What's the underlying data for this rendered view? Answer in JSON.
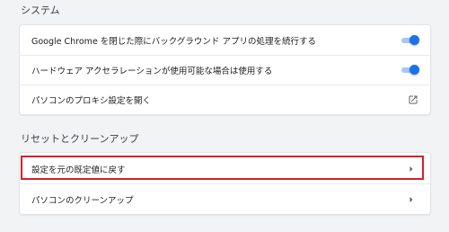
{
  "system": {
    "title": "システム",
    "items": [
      {
        "label": "Google Chrome を閉じた際にバックグラウンド アプリの処理を続行する",
        "enabled": true
      },
      {
        "label": "ハードウェア アクセラレーションが使用可能な場合は使用する",
        "enabled": true
      },
      {
        "label": "パソコンのプロキシ設定を開く",
        "icon": "open-in-new-icon"
      }
    ]
  },
  "reset": {
    "title": "リセットとクリーンアップ",
    "items": [
      {
        "label": "設定を元の既定値に戻す",
        "icon": "chevron-right-icon",
        "highlighted": true
      },
      {
        "label": "パソコンのクリーンアップ",
        "icon": "chevron-right-icon"
      }
    ]
  },
  "colors": {
    "toggle_on": "#1a73e8",
    "highlight_border": "#d6202a"
  }
}
